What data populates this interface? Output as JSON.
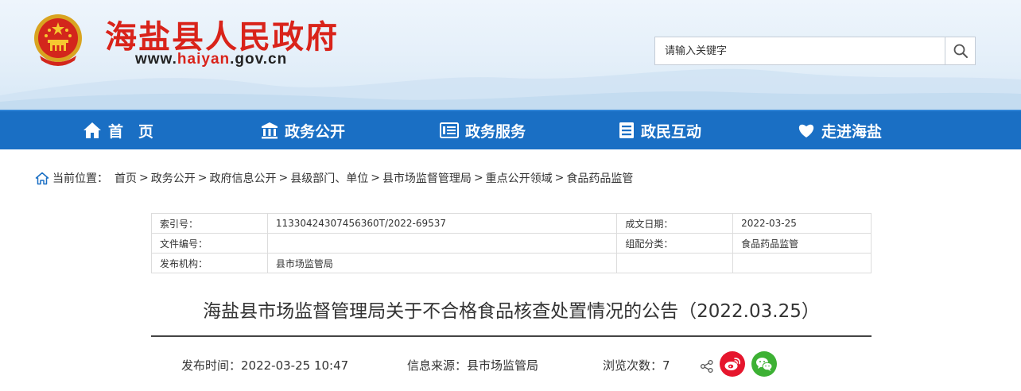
{
  "header": {
    "site_title": "海盐县人民政府",
    "url_prefix": "www.",
    "url_highlight": "haiyan",
    "url_suffix": ".gov.cn",
    "emblem_icon": "national-emblem-icon"
  },
  "search": {
    "placeholder": "请输入关键字",
    "button_icon": "search-icon"
  },
  "nav": {
    "items": [
      {
        "label": "首　页",
        "icon": "home-icon"
      },
      {
        "label": "政务公开",
        "icon": "columns-building-icon"
      },
      {
        "label": "政务服务",
        "icon": "list-document-icon"
      },
      {
        "label": "政民互动",
        "icon": "clipboard-icon"
      },
      {
        "label": "走进海盐",
        "icon": "heart-icon"
      }
    ]
  },
  "breadcrumb": {
    "prefix": "当前位置：",
    "items": [
      "首页",
      "政务公开",
      "政府信息公开",
      "县级部门、单位",
      "县市场监督管理局",
      "重点公开领域",
      "食品药品监管"
    ],
    "separator": ">"
  },
  "meta": {
    "rows": [
      {
        "k1": "索引号：",
        "v1": "11330424307456360T/2022-69537",
        "k2": "成文日期：",
        "v2": "2022-03-25"
      },
      {
        "k1": "文件编号：",
        "v1": "",
        "k2": "组配分类：",
        "v2": "食品药品监管"
      },
      {
        "k1": "发布机构：",
        "v1": "县市场监管局",
        "k2": "",
        "v2": ""
      }
    ]
  },
  "article": {
    "title": "海盐县市场监督管理局关于不合格食品核查处置情况的公告（2022.03.25）",
    "publish_time": "发布时间：2022-03-25 10:47",
    "source": "信息来源：县市场监管局",
    "views": "浏览次数：7"
  },
  "share": {
    "share_icon": "share-icon",
    "weibo_icon": "weibo-icon",
    "wechat_icon": "wechat-icon"
  },
  "colors": {
    "brand_red": "#d9231a",
    "nav_blue": "#1a6fc4",
    "weibo_red": "#e6162d",
    "wechat_green": "#3db134"
  }
}
